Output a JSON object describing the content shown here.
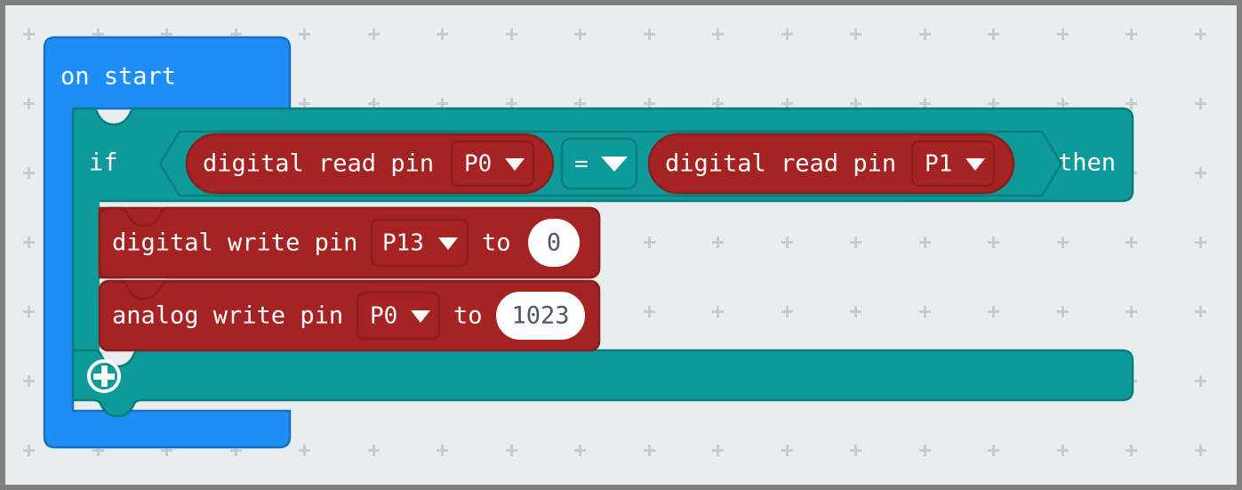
{
  "canvas": {
    "background_color": "#e8eded",
    "border_color": "#808080",
    "grid_marker": "plus-marker"
  },
  "palette": {
    "event_block": "#1e8ef5",
    "event_block_border": "#1a6fc4",
    "logic_block": "#0d9a9a",
    "logic_block_border": "#0b7d7d",
    "pins_block": "#a52323",
    "pins_block_border": "#8a1d1d",
    "input_field_bg": "#ffffff",
    "input_field_text": "#49586b",
    "block_text": "#ffffff"
  },
  "program": {
    "event": {
      "name": "on-start",
      "label": "on start"
    },
    "conditional": {
      "name": "if-then",
      "if_label": "if",
      "then_label": "then",
      "add_label": "+",
      "add_icon": "plus-circle-icon"
    },
    "condition": {
      "name": "comparison",
      "operator": "=",
      "operator_dropdown_icon": "chevron-down-icon",
      "left": {
        "name": "digital-read-pin",
        "label": "digital read pin",
        "pin": "P0",
        "dropdown_icon": "chevron-down-icon"
      },
      "right": {
        "name": "digital-read-pin",
        "label": "digital read pin",
        "pin": "P1",
        "dropdown_icon": "chevron-down-icon"
      }
    },
    "statements": [
      {
        "name": "digital-write-pin",
        "label": "digital write pin",
        "pin": "P13",
        "to_label": "to",
        "value": "0",
        "dropdown_icon": "chevron-down-icon"
      },
      {
        "name": "analog-write-pin",
        "label": "analog write pin",
        "pin": "P0",
        "to_label": "to",
        "value": "1023",
        "dropdown_icon": "chevron-down-icon"
      }
    ]
  }
}
